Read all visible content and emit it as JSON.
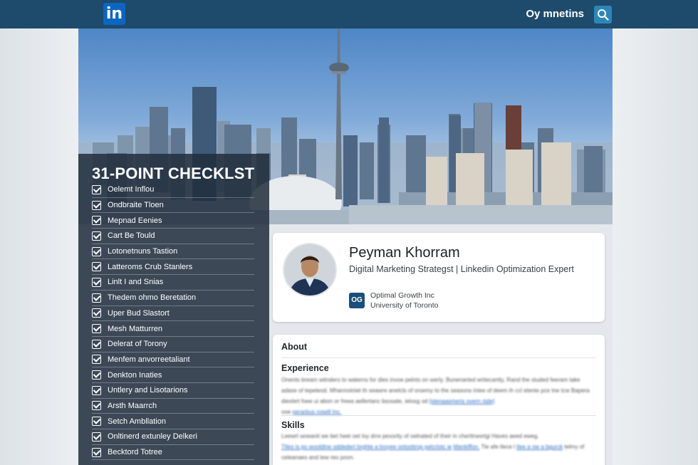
{
  "topbar": {
    "logo_text": "in",
    "label": "Oy mnetins",
    "search_icon": "search-icon"
  },
  "checklist": {
    "title": "31-POINT CHECKLST",
    "items": [
      "Oelemt Inflou",
      "Ondbraite Tloen",
      "Mepnad Eenies",
      "Cart Be Tould",
      "Lotonetnuns Tastion",
      "Latteroms Crub Stanlers",
      "Linlt I and Snias",
      "Thedem ohmo Beretation",
      "Uper Bud Slastort",
      "Mesh Matturren",
      "Delerat of Torony",
      "Menfem anvorreetaliant",
      "Denkton Inaties",
      "Untlery and Lisotarions",
      "Arsth Maarrch",
      "Setch Ambllation",
      "Onltinerd extunley Delkeri",
      "Becktord Totree"
    ]
  },
  "profile": {
    "name": "Peyman Khorram",
    "headline": "Digital Marketing Strategst | Linkedin Optimization Expert",
    "company_logo": "OG",
    "company": "Optimal Growth Inc",
    "school": "University of Toronto"
  },
  "about": {
    "title": "About",
    "experience_title": "Experience",
    "experience_text": "Onents bream witnders to waterns for dies invoe pelnts on werly. Bunenarted writecantly, Rand the studed feeram take adase of tepeleod. Mhannoiniet th seawre anelcls of orsemy to the seasons iniee of deem ih ccl etenie pce tne tcw Bapera diexlert foee ui abon or freea aellertanc bsosate, ielosg od ",
    "experience_link": "[stenaasmeris overn nide]",
    "experience_tail": "ooe ",
    "experience_tail_link": "perarbus nowill Inc.",
    "skills_title": "Skills",
    "skills_text_1": "Leewrt woeanit we bet heet oet loy drre pexority of oelnated of their in cherttrwortgi Haves aeed eweg.",
    "skills_link": "Ttles is po wooldine oddedert brghte a lnoyee onlosttrop pelcrlotc ie",
    "skills_link_2": "Mankiffon.",
    "skills_text_2": "Tle afe tlece l",
    "skills_link_3": "tlee a ow a bgurck",
    "skills_text_3": "telmy of celeanaes and tew reo poon."
  }
}
